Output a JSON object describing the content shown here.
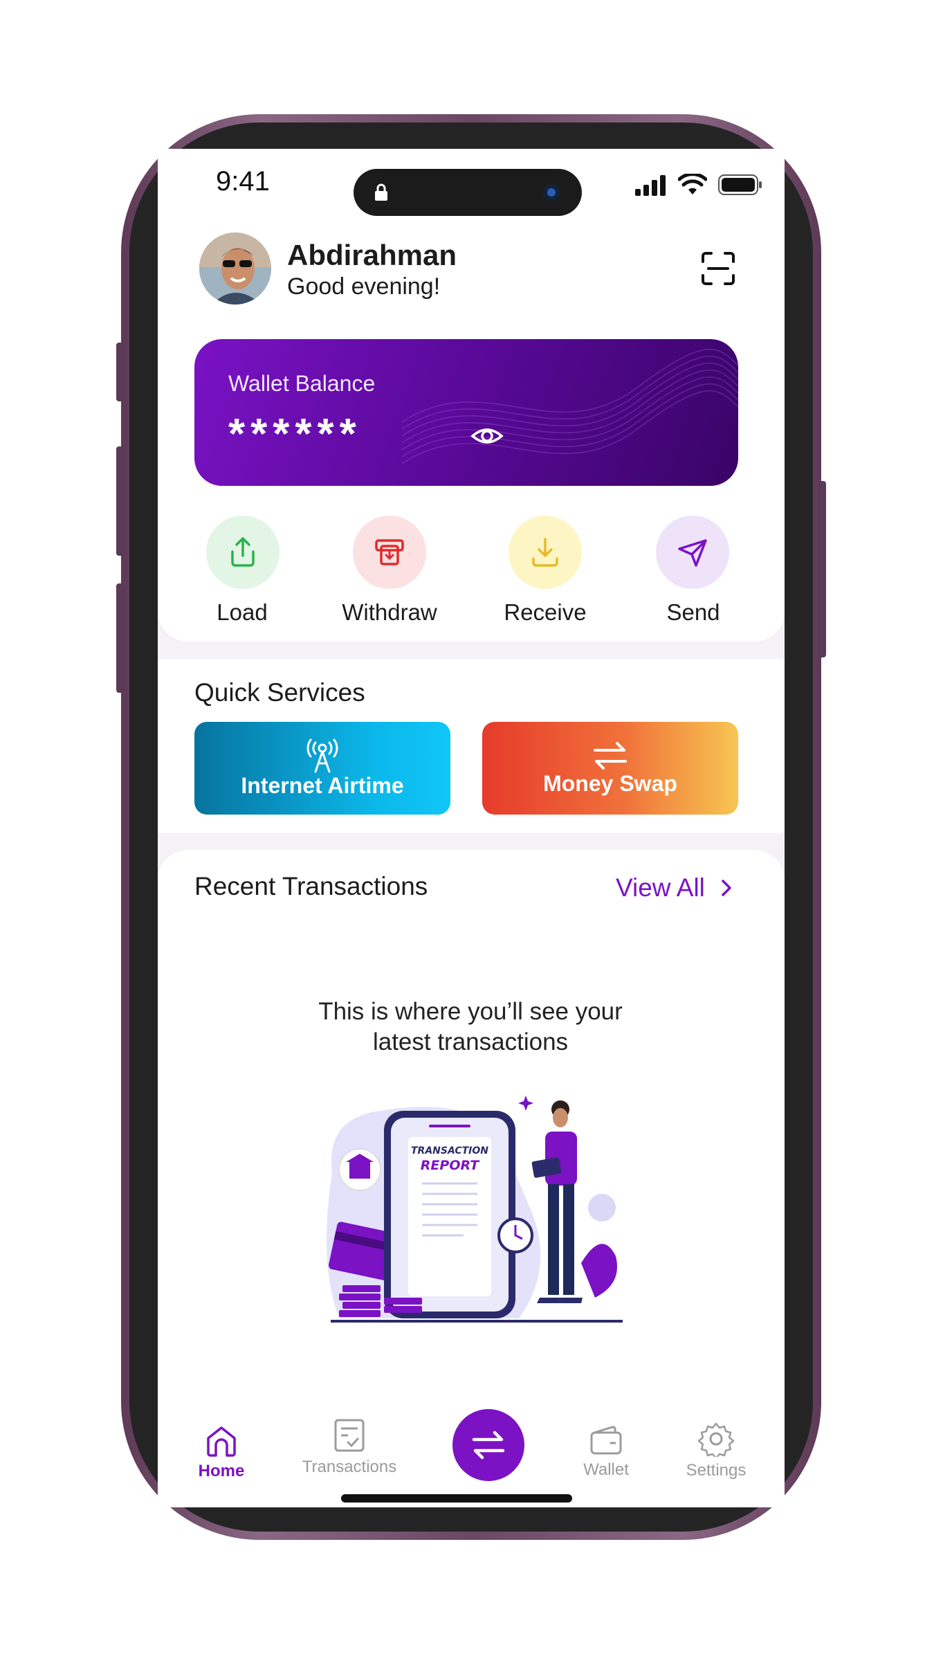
{
  "status_bar": {
    "time": "9:41"
  },
  "header": {
    "user_name": "Abdirahman",
    "greeting": "Good evening!"
  },
  "wallet": {
    "label": "Wallet Balance",
    "masked_balance": "******"
  },
  "actions": [
    {
      "label": "Load",
      "icon": "upload-icon",
      "bg": "#e3f6e6",
      "fg": "#2bb24c"
    },
    {
      "label": "Withdraw",
      "icon": "withdraw-icon",
      "bg": "#fbe1e1",
      "fg": "#e02a2a"
    },
    {
      "label": "Receive",
      "icon": "download-icon",
      "bg": "#fdf6c4",
      "fg": "#e7b92b"
    },
    {
      "label": "Send",
      "icon": "send-icon",
      "bg": "#efe3f9",
      "fg": "#7b12c4"
    }
  ],
  "quick_services": {
    "title": "Quick Services",
    "items": [
      {
        "label": "Internet Airtime",
        "icon": "antenna-icon"
      },
      {
        "label": "Money Swap",
        "icon": "swap-arrows-icon"
      }
    ]
  },
  "recent": {
    "title": "Recent Transactions",
    "view_all": "View All",
    "empty_line1": "This is where you’ll see your",
    "empty_line2": "latest transactions",
    "illustration": {
      "title": "TRANSACTION",
      "subtitle": "REPORT"
    }
  },
  "nav": {
    "items": [
      {
        "label": "Home",
        "icon": "home-icon",
        "active": true
      },
      {
        "label": "Transactions",
        "icon": "transactions-icon",
        "active": false
      },
      {
        "label": "Wallet",
        "icon": "wallet-icon",
        "active": false
      },
      {
        "label": "Settings",
        "icon": "settings-icon",
        "active": false
      }
    ]
  },
  "colors": {
    "brand": "#7b12c4",
    "inactive": "#9b9b9b"
  }
}
